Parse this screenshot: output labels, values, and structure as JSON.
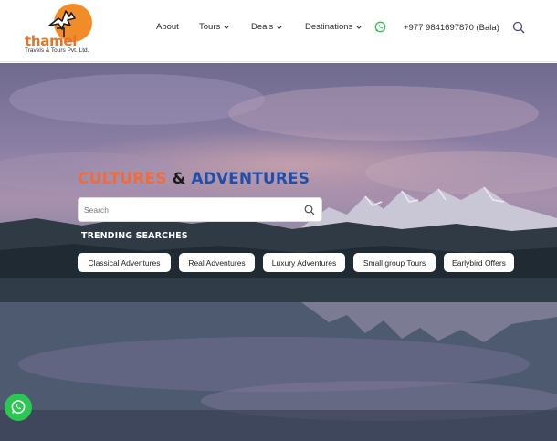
{
  "brand": {
    "name": "thamel",
    "tagline": "Travels & Tours Pvt. Ltd.",
    "logo_color": "#f28c28"
  },
  "nav": {
    "items": [
      {
        "label": "About",
        "dropdown": false
      },
      {
        "label": "Tours",
        "dropdown": true
      },
      {
        "label": "Deals",
        "dropdown": true
      },
      {
        "label": "Destinations",
        "dropdown": true
      }
    ],
    "whatsapp_icon": "whatsapp-icon",
    "phone": "+977 9841697870 (Bala)",
    "search_icon": "search-icon"
  },
  "hero": {
    "headline_part1": "CULTURES",
    "headline_part2": "&",
    "headline_part3": "ADVENTURES",
    "colors": {
      "part1": "#f26b3a",
      "part2": "#1a1a1a",
      "part3": "#1f4fa8"
    },
    "search": {
      "placeholder": "Search",
      "value": ""
    },
    "trending_title": "TRENDING SEARCHES",
    "trending": [
      "Classical Adventures",
      "Real Adventures",
      "Luxury Adventures",
      "Small group Tours",
      "Earlybird Offers"
    ]
  },
  "floating": {
    "whatsapp_color": "#2cc653"
  }
}
